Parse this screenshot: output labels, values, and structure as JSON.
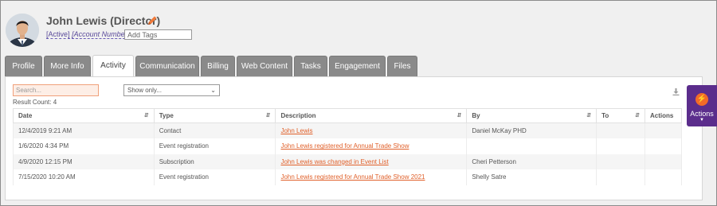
{
  "contact": {
    "name": "John Lewis (Director)",
    "status_label": "Active",
    "account_label": "Account Number",
    "add_tags_placeholder": "Add Tags"
  },
  "tabs": [
    {
      "label": "Profile",
      "active": false
    },
    {
      "label": "More Info",
      "active": false
    },
    {
      "label": "Activity",
      "active": true
    },
    {
      "label": "Communication",
      "active": false
    },
    {
      "label": "Billing",
      "active": false
    },
    {
      "label": "Web Content",
      "active": false
    },
    {
      "label": "Tasks",
      "active": false
    },
    {
      "label": "Engagement",
      "active": false
    },
    {
      "label": "Files",
      "active": false
    }
  ],
  "activity": {
    "search_placeholder": "Search...",
    "show_only_label": "Show only...",
    "result_count": "Result Count: 4",
    "columns": [
      "Date",
      "Type",
      "Description",
      "By",
      "To",
      "Actions"
    ],
    "rows": [
      {
        "date": "12/4/2019 9:21 AM",
        "type": "Contact",
        "description": "John Lewis",
        "by": "Daniel McKay PHD",
        "to": ""
      },
      {
        "date": "1/6/2020 4:34 PM",
        "type": "Event registration",
        "description": "John Lewis registered for Annual Trade Show",
        "by": "",
        "to": ""
      },
      {
        "date": "4/9/2020 12:15 PM",
        "type": "Subscription",
        "description": "John Lewis was changed in Event List",
        "by": "Cheri Petterson",
        "to": ""
      },
      {
        "date": "7/15/2020 10:20 AM",
        "type": "Event registration",
        "description": "John Lewis registered for Annual Trade Show 2021",
        "by": "Shelly Satre",
        "to": ""
      }
    ]
  },
  "actions_button": {
    "label": "Actions"
  },
  "colors": {
    "accent": "#5b2d8c",
    "link": "#e0602a",
    "tab": "#8a8a8a"
  },
  "icons": {
    "edit": "pencil-icon",
    "download": "download-icon",
    "actions": "bolt-icon",
    "sort": "sort-icon",
    "dropdown": "chevron-down-icon"
  }
}
